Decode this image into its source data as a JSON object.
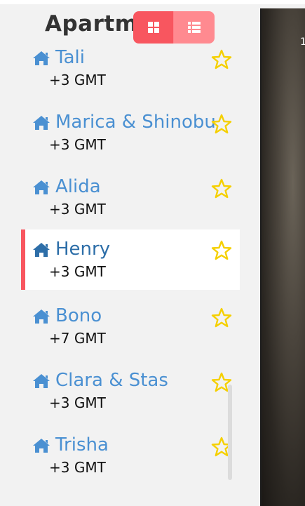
{
  "header": {
    "title": "Apartments",
    "view_grid_label": "grid view",
    "view_list_label": "list view"
  },
  "apartments": [
    {
      "name": "Tali",
      "timezone": "+3 GMT",
      "favorite": false
    },
    {
      "name": "Marica & Shinobu",
      "timezone": "+3 GMT",
      "favorite": false
    },
    {
      "name": "Alida",
      "timezone": "+3 GMT",
      "favorite": false
    },
    {
      "name": "Henry",
      "timezone": "+3 GMT",
      "favorite": false,
      "selected": true
    },
    {
      "name": "Bono",
      "timezone": "+7 GMT",
      "favorite": false
    },
    {
      "name": "Clara & Stas",
      "timezone": "+3 GMT",
      "favorite": false
    },
    {
      "name": "Trisha",
      "timezone": "+3 GMT",
      "favorite": false
    }
  ],
  "photo": {
    "corner_text": "1"
  },
  "colors": {
    "accent": "#f8565f",
    "link": "#4a90d2",
    "star": "#f5d000",
    "background": "#f2f2f2"
  }
}
